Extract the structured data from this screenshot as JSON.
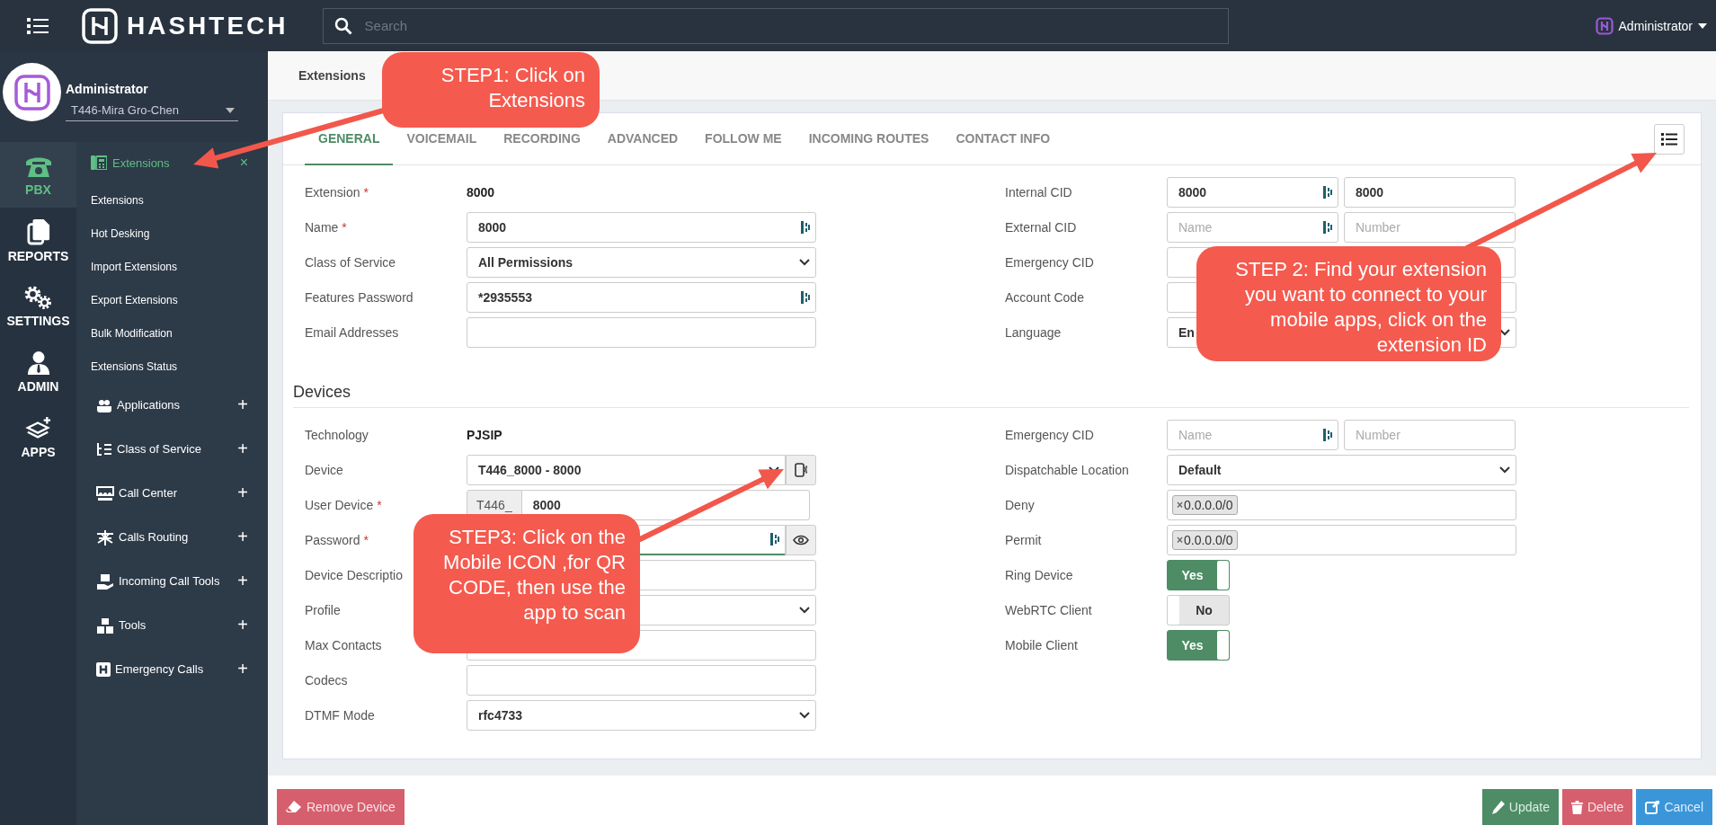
{
  "topbar": {
    "brand": "HASHTECH",
    "search": {
      "placeholder": "Search"
    },
    "user": "Administrator"
  },
  "profile": {
    "name": "Administrator",
    "tenant": "T446-Mira Gro-Chen"
  },
  "rail": [
    {
      "label": "PBX",
      "kind": "phone",
      "selected": true
    },
    {
      "label": "REPORTS",
      "kind": "documents",
      "selected": false
    },
    {
      "label": "SETTINGS",
      "kind": "gears",
      "selected": false
    },
    {
      "label": "ADMIN",
      "kind": "person",
      "selected": false
    },
    {
      "label": "APPS",
      "kind": "layers",
      "selected": false
    }
  ],
  "submenu": {
    "header": {
      "label": "Extensions",
      "close": "×"
    },
    "items": [
      "Extensions",
      "Hot Desking",
      "Import Extensions",
      "Export Extensions",
      "Bulk Modification",
      "Extensions Status"
    ],
    "groups": [
      {
        "label": "Applications",
        "kind": "apps",
        "expand": "+"
      },
      {
        "label": "Class of Service",
        "kind": "list",
        "expand": "+"
      },
      {
        "label": "Call Center",
        "kind": "center",
        "expand": "+"
      },
      {
        "label": "Calls Routing",
        "kind": "routing",
        "expand": "+"
      },
      {
        "label": "Incoming Call Tools",
        "kind": "hand",
        "expand": "+"
      },
      {
        "label": "Tools",
        "kind": "boxes",
        "expand": "+"
      },
      {
        "label": "Emergency Calls",
        "kind": "hospital",
        "expand": "+"
      }
    ]
  },
  "breadcrumb": "Extensions",
  "tabs": [
    {
      "label": "GENERAL",
      "selected": true
    },
    {
      "label": "VOICEMAIL",
      "selected": false
    },
    {
      "label": "RECORDING",
      "selected": false
    },
    {
      "label": "ADVANCED",
      "selected": false
    },
    {
      "label": "FOLLOW ME",
      "selected": false
    },
    {
      "label": "INCOMING ROUTES",
      "selected": false
    },
    {
      "label": "CONTACT INFO",
      "selected": false
    }
  ],
  "general_left": [
    {
      "label": "Extension",
      "mark": "*",
      "kind": "static",
      "value": "8000"
    },
    {
      "label": "Name",
      "mark": "*",
      "kind": "input",
      "value": "8000",
      "autofill": true
    },
    {
      "label": "Class of Service",
      "kind": "select",
      "value": "All Permissions"
    },
    {
      "label": "Features Password",
      "kind": "input",
      "value": "*2935553",
      "autofill": true
    },
    {
      "label": "Email Addresses",
      "kind": "input"
    }
  ],
  "general_right": [
    {
      "label": "Internal CID",
      "kind": "pair",
      "fields": [
        {
          "value": "8000",
          "autofill": true
        },
        {
          "value": "8000"
        }
      ]
    },
    {
      "label": "External CID",
      "kind": "pair",
      "fields": [
        {
          "placeholder": "Name",
          "autofill": true
        },
        {
          "placeholder": "Number"
        }
      ]
    },
    {
      "label": "Emergency CID",
      "kind": "pair"
    },
    {
      "label": "Account Code",
      "kind": "input"
    },
    {
      "label": "Language",
      "kind": "select",
      "value": "En"
    }
  ],
  "section": "Devices",
  "devices_left": [
    {
      "label": "Technology",
      "kind": "static",
      "value": "PJSIP"
    },
    {
      "label": "Device",
      "kind": "select_button",
      "value": "T446_8000 - 8000"
    },
    {
      "label": "User Device",
      "mark": "*",
      "kind": "prefixed",
      "prefix": "T446_",
      "value": "8000"
    },
    {
      "label": "Password",
      "mark": "*",
      "kind": "password",
      "autofill": true,
      "focused": true
    },
    {
      "label": "Device Descriptio",
      "kind": "input"
    },
    {
      "label": "Profile",
      "kind": "select"
    },
    {
      "label": "Max Contacts",
      "kind": "input"
    },
    {
      "label": "Codecs",
      "kind": "input"
    },
    {
      "label": "DTMF Mode",
      "kind": "select",
      "value": "rfc4733"
    }
  ],
  "devices_right": [
    {
      "label": "Emergency CID",
      "kind": "pair",
      "fields": [
        {
          "placeholder": "Name",
          "autofill": true
        },
        {
          "placeholder": "Number"
        }
      ]
    },
    {
      "label": "Dispatchable Location",
      "kind": "select",
      "value": "Default"
    },
    {
      "label": "Deny",
      "kind": "tags",
      "tags": [
        {
          "remove": "×",
          "label": "0.0.0.0/0"
        }
      ]
    },
    {
      "label": "Permit",
      "kind": "tags",
      "tags": [
        {
          "remove": "×",
          "label": "0.0.0.0/0"
        }
      ]
    },
    {
      "label": "Ring Device",
      "kind": "toggle",
      "on": true,
      "text": "Yes"
    },
    {
      "label": "WebRTC Client",
      "kind": "toggle",
      "on": false,
      "text": "No"
    },
    {
      "label": "Mobile Client",
      "kind": "toggle",
      "on": true,
      "text": "Yes"
    }
  ],
  "footer": {
    "left": [
      {
        "label": "Remove Device",
        "kind": "danger"
      }
    ],
    "right": [
      {
        "label": "Update",
        "kind": "success"
      },
      {
        "label": "Delete",
        "kind": "danger"
      },
      {
        "label": "Cancel",
        "kind": "primary"
      }
    ]
  },
  "callouts": [
    {
      "text": "STEP1: Click on\nExtensions"
    },
    {
      "text": "STEP 2: Find your extension\nyou want to connect to your\nmobile apps, click on the\nextension ID"
    },
    {
      "text": "STEP3: Click on the\nMobile ICON ,for QR\nCODE, then use the\napp to scan"
    }
  ]
}
